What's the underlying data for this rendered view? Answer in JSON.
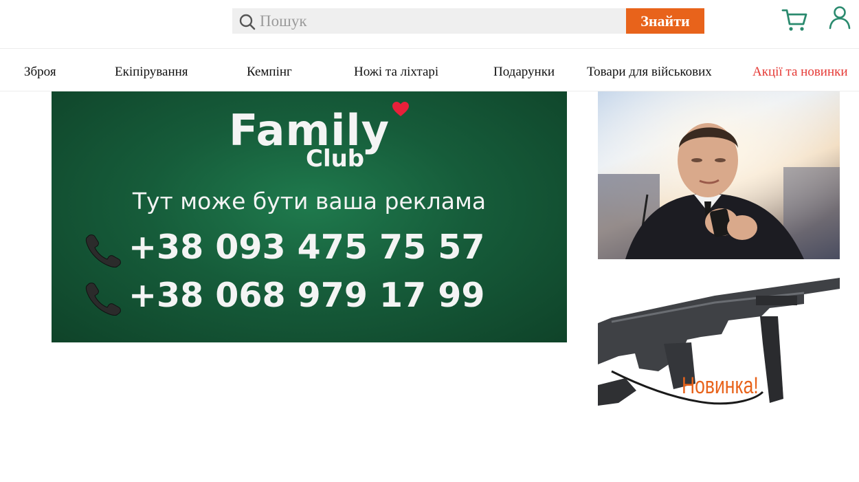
{
  "search": {
    "placeholder": "Пошук",
    "value": "",
    "button_label": "Знайти"
  },
  "header": {
    "cart_icon": "cart-icon",
    "user_icon": "user-icon"
  },
  "nav": {
    "items": [
      {
        "label": "Зброя"
      },
      {
        "label": "Екіпірування"
      },
      {
        "label": "Кемпінг"
      },
      {
        "label": "Ножі та ліхтарі"
      },
      {
        "label": "Подарунки"
      },
      {
        "label": "Товари для військових"
      },
      {
        "label": "Акції та новинки",
        "highlight": true
      }
    ]
  },
  "banner": {
    "brand": "Family",
    "brand_sub": "Club",
    "tagline": "Тут може бути ваша реклама",
    "phones": [
      "+38 093 475 75 57",
      "+38 068 979 17 99"
    ]
  },
  "side_ads": {
    "new_item_caption": "Новинка!"
  },
  "colors": {
    "accent": "#e8631b",
    "highlight": "#e53935",
    "icon": "#2a8a6e",
    "banner_green": "#165c3a"
  }
}
